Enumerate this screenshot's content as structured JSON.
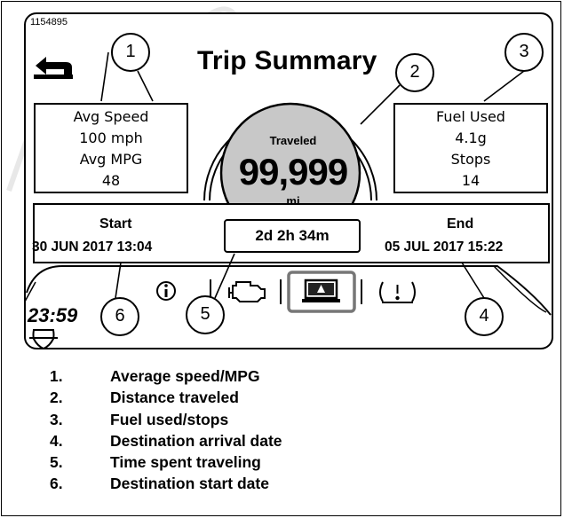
{
  "figure_id": "1154895",
  "screen": {
    "title": "Trip Summary",
    "back_icon": "back-arrow-icon",
    "avg_box": {
      "line1": "Avg Speed",
      "line2": "100 mph",
      "line3": "Avg MPG",
      "line4": "48"
    },
    "fuel_box": {
      "line1": "Fuel Used",
      "line2": "4.1g",
      "line3": "Stops",
      "line4": "14"
    },
    "gauge": {
      "label": "Traveled",
      "value": "99,999",
      "unit": "mi"
    },
    "start": {
      "label": "Start",
      "date": "30 JUN 2017 13:04"
    },
    "end": {
      "label": "End",
      "date": "05 JUL 2017 15:22"
    },
    "elapsed": "2d 2h 34m",
    "clock": "23:59",
    "bottom_icons": [
      "info-icon",
      "engine-icon",
      "trip-summary-icon",
      "tire-pressure-icon"
    ],
    "brand_icon": "bar-and-shield-icon"
  },
  "callouts": [
    "1",
    "2",
    "3",
    "4",
    "5",
    "6"
  ],
  "legend": [
    {
      "num": "1.",
      "text": "Average speed/MPG"
    },
    {
      "num": "2.",
      "text": "Distance traveled"
    },
    {
      "num": "3.",
      "text": "Fuel used/stops"
    },
    {
      "num": "4.",
      "text": "Destination arrival date"
    },
    {
      "num": "5.",
      "text": "Time spent traveling"
    },
    {
      "num": "6.",
      "text": "Destination start date"
    }
  ],
  "colors": {
    "gauge_fill": "#c8c8c8",
    "selected_border": "#777777",
    "watermark": "#e8e8e8"
  }
}
